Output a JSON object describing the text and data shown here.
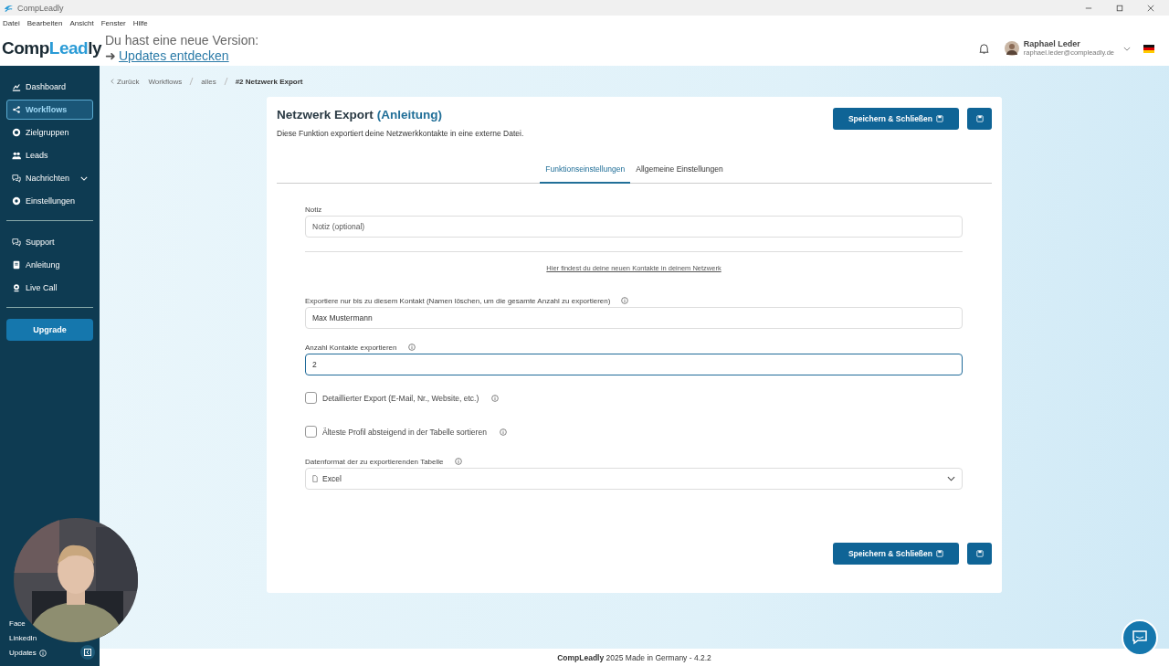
{
  "window": {
    "title": "CompLeadly"
  },
  "menu": [
    "Datei",
    "Bearbeiten",
    "Ansicht",
    "Fenster",
    "Hilfe"
  ],
  "logo": [
    {
      "text": "Comp",
      "accent": false
    },
    {
      "text": "Lead",
      "accent": true
    },
    {
      "text": "ly",
      "accent": false
    }
  ],
  "update_notice": {
    "text": "Du hast eine neue Version:",
    "arrow": "➜",
    "link": "Updates entdecken"
  },
  "user": {
    "name": "Raphael Leder",
    "email": "raphael.leder@compleadly.de"
  },
  "sidebar": {
    "groups": [
      [
        {
          "label": "Dashboard",
          "selected": false,
          "expandable": false
        },
        {
          "label": "Workflows",
          "selected": true,
          "expandable": false
        },
        {
          "label": "Zielgruppen",
          "selected": false,
          "expandable": false
        },
        {
          "label": "Leads",
          "selected": false,
          "expandable": false
        },
        {
          "label": "Nachrichten",
          "selected": false,
          "expandable": true
        },
        {
          "label": "Einstellungen",
          "selected": false,
          "expandable": false
        }
      ],
      [
        {
          "label": "Support",
          "selected": false,
          "expandable": false
        },
        {
          "label": "Anleitung",
          "selected": false,
          "expandable": false
        },
        {
          "label": "Live Call",
          "selected": false,
          "expandable": false
        }
      ]
    ],
    "upgrade": "Upgrade",
    "links": [
      "Face",
      "LinkedIn",
      "Updates"
    ]
  },
  "breadcrumb": {
    "back": "Zurück",
    "items": [
      {
        "label": "Workflows",
        "selected": false
      },
      {
        "label": "alles",
        "selected": false
      },
      {
        "label": "#2 Netzwerk Export",
        "selected": true
      }
    ]
  },
  "card": {
    "title": "Netzwerk Export",
    "title_link": "(Anleitung)",
    "save_button": "Speichern & Schließen",
    "footer_save_button": "Speichern & Schließen",
    "description": "Diese Funktion exportiert deine Netzwerkkontakte in eine externe Datei.",
    "tabs": [
      {
        "label": "Funktionseinstellungen",
        "selected": true
      },
      {
        "label": "Allgemeine Einstellungen",
        "selected": false
      }
    ],
    "fields": [
      {
        "kind": "text",
        "label": "Notiz",
        "placeholder": "Notiz (optional)",
        "info": false,
        "focused": false
      },
      {
        "kind": "link",
        "text": "Hier findest du deine neuen Kontakte in deinem Netzwerk"
      },
      {
        "kind": "text",
        "label": "Exportiere nur bis zu diesem Kontakt (Namen löschen, um die gesamte Anzahl zu exportieren)",
        "value": "Max Mustermann",
        "info": true,
        "focused": false
      },
      {
        "kind": "text",
        "label": "Anzahl Kontakte exportieren",
        "value": "2",
        "info": true,
        "focused": true
      },
      {
        "kind": "checkbox",
        "label": "Detaillierter Export (E-Mail, Nr., Website, etc.)",
        "checked": false,
        "info": true
      },
      {
        "kind": "checkbox",
        "label": "Älteste Profil absteigend in der Tabelle sortieren",
        "checked": false,
        "info": true
      },
      {
        "kind": "select",
        "label": "Datenformat der zu exportierenden Tabelle",
        "value": "Excel",
        "info": true
      }
    ]
  },
  "footer": "**CompLeadly** 2025 Made in Germany - 4.2.2",
  "webcam": {
    "kind": "picture"
  }
}
